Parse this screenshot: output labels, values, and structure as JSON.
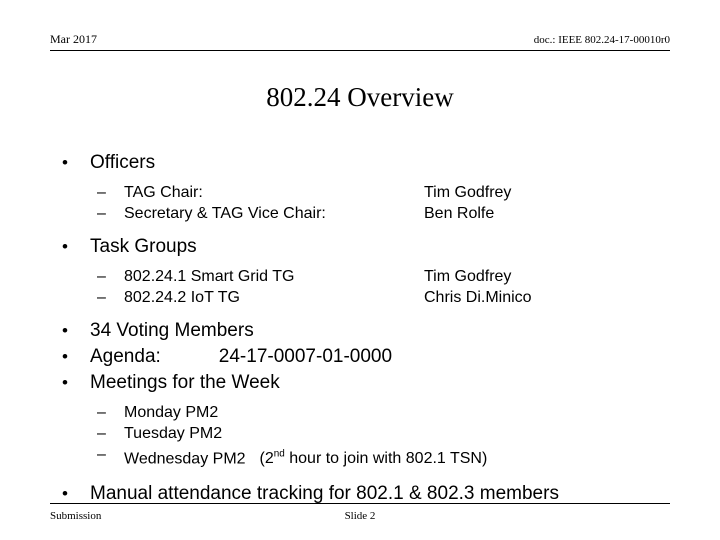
{
  "header": {
    "date": "Mar 2017",
    "doc": "doc.: IEEE 802.24-17-00010r0"
  },
  "title": "802.24 Overview",
  "content": {
    "officers_heading": "Officers",
    "officers": [
      {
        "dash": "–",
        "role": "TAG Chair:",
        "name": "Tim Godfrey"
      },
      {
        "dash": "–",
        "role": "Secretary & TAG Vice Chair:",
        "name": "Ben Rolfe"
      }
    ],
    "task_groups_heading": "Task Groups",
    "task_groups": [
      {
        "dash": "–",
        "group": "802.24.1 Smart Grid TG",
        "lead": "Tim Godfrey"
      },
      {
        "dash": "–",
        "group": "802.24.2 IoT TG",
        "lead": "Chris Di.Minico"
      }
    ],
    "voting_members": "34 Voting Members",
    "agenda_label": "Agenda:",
    "agenda_value": "24-17-0007-01-0000",
    "meetings_heading": "Meetings for the Week",
    "meetings": [
      {
        "dash": "–",
        "day": "Monday PM2",
        "note": ""
      },
      {
        "dash": "–",
        "day": "Tuesday PM2",
        "note": ""
      },
      {
        "dash": "–",
        "day": "Wednesday PM2",
        "note_pre": "(2",
        "note_sup": "nd",
        "note_post": " hour to join with 802.1 TSN)"
      }
    ],
    "manual_attendance": "Manual attendance tracking for 802.1 & 802.3 members",
    "bullet_glyph": "•"
  },
  "footer": {
    "left": "Submission",
    "center": "Slide 2"
  }
}
